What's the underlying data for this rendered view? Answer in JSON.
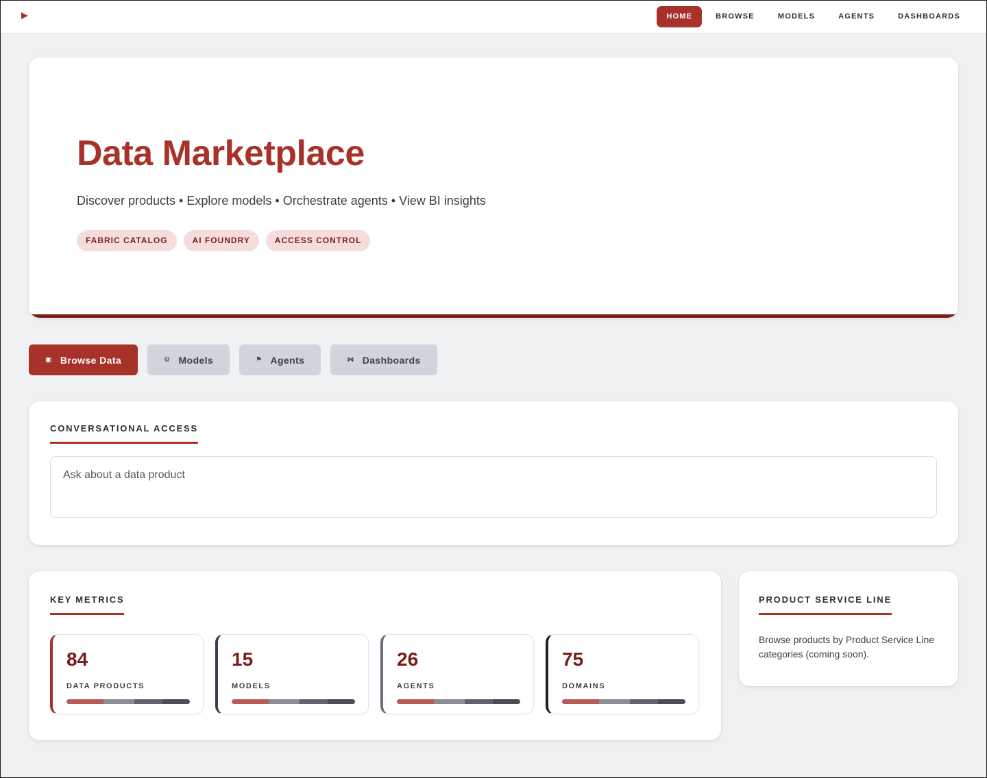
{
  "nav": {
    "items": [
      {
        "label": "HOME",
        "active": true
      },
      {
        "label": "BROWSE",
        "active": false
      },
      {
        "label": "MODELS",
        "active": false
      },
      {
        "label": "AGENTS",
        "active": false
      },
      {
        "label": "DASHBOARDS",
        "active": false
      }
    ]
  },
  "hero": {
    "title": "Data Marketplace",
    "subtitle": "Discover products • Explore models • Orchestrate agents • View BI insights",
    "chips": [
      "FABRIC CATALOG",
      "AI FOUNDRY",
      "ACCESS CONTROL"
    ]
  },
  "actions": [
    {
      "label": "Browse Data",
      "icon": "▣",
      "icon_name": "data-icon",
      "primary": true
    },
    {
      "label": "Models",
      "icon": "⚙",
      "icon_name": "gear-icon",
      "primary": false
    },
    {
      "label": "Agents",
      "icon": "⚑",
      "icon_name": "flag-icon",
      "primary": false
    },
    {
      "label": "Dashboards",
      "icon": "⋈",
      "icon_name": "dashboard-icon",
      "primary": false
    }
  ],
  "conversational": {
    "title": "CONVERSATIONAL ACCESS",
    "placeholder": "Ask about a data product"
  },
  "metrics": {
    "title": "KEY METRICS",
    "items": [
      {
        "value": "84",
        "label": "DATA PRODUCTS"
      },
      {
        "value": "15",
        "label": "MODELS"
      },
      {
        "value": "26",
        "label": "AGENTS"
      },
      {
        "value": "75",
        "label": "DOMAINS"
      }
    ],
    "bar_colors": [
      "#b85a55",
      "#8a8d96",
      "#5f6270",
      "#4a4c56"
    ]
  },
  "psl": {
    "title": "PRODUCT SERVICE LINE",
    "text": "Browse products by Product Service Line categories (coming soon)."
  },
  "colors": {
    "accent": "#a8322a",
    "accent_dark": "#7a1d17",
    "chip_bg": "#f6dddd",
    "page_bg": "#f0f1f3"
  }
}
